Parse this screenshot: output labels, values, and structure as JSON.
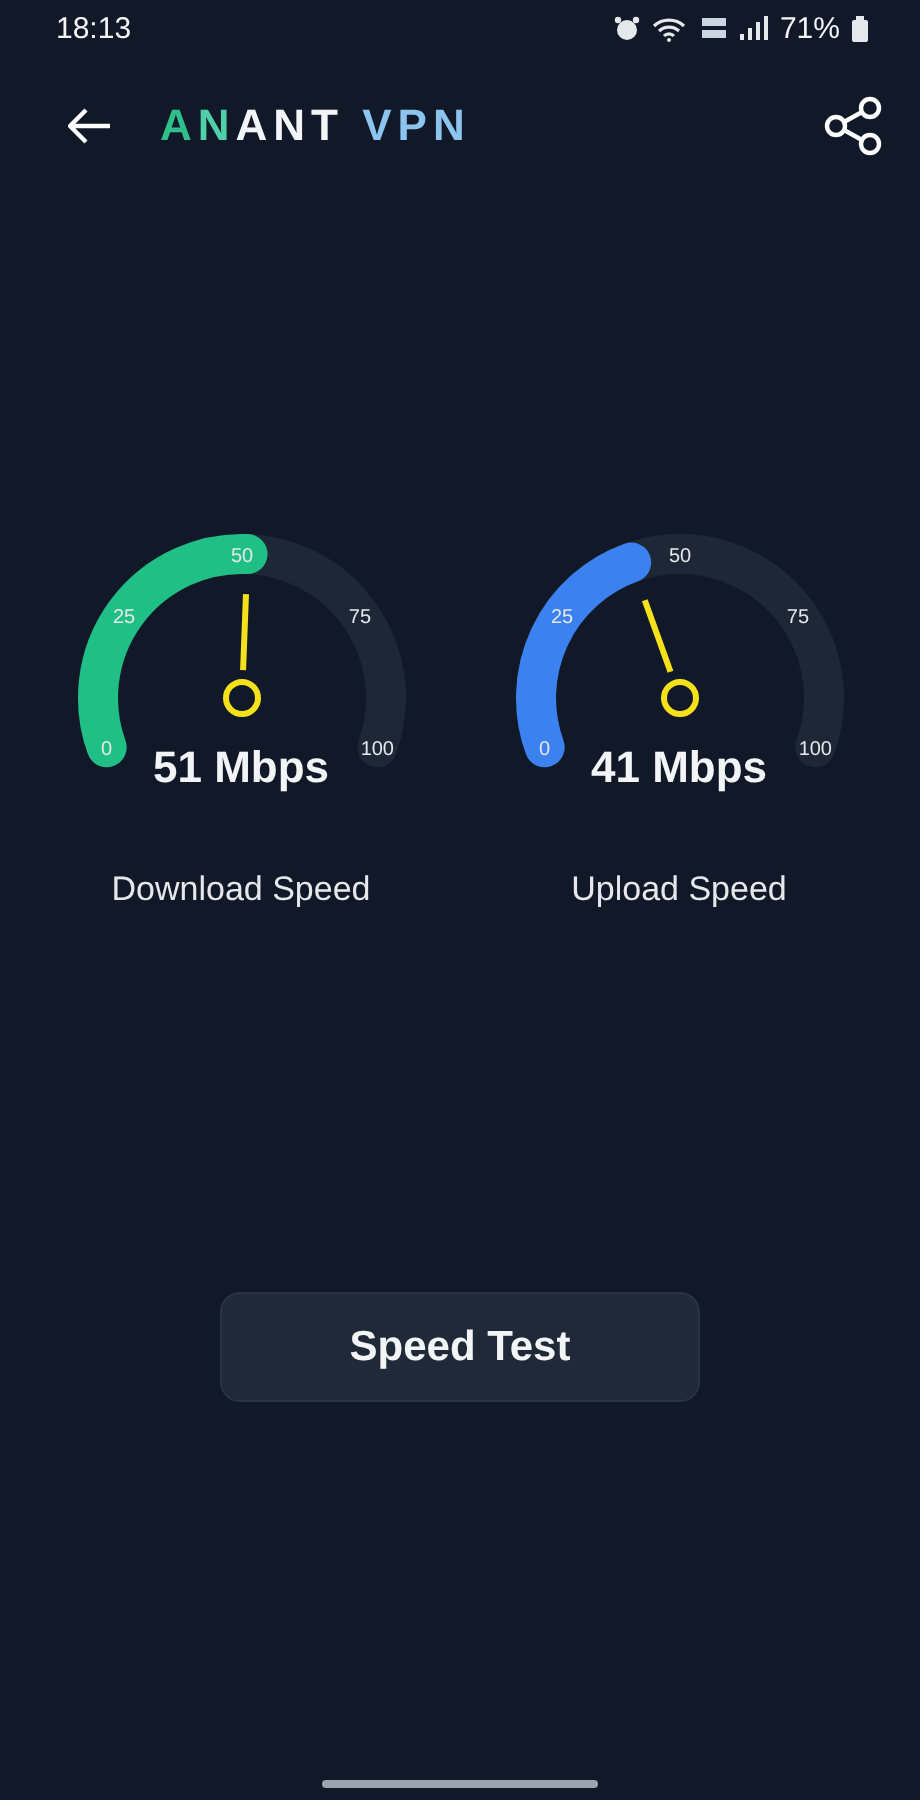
{
  "status_bar": {
    "time": "18:13",
    "battery": "71%"
  },
  "header": {
    "title": [
      {
        "text": "A",
        "color": "#2fbf8c"
      },
      {
        "text": "N",
        "color": "#4fd0a8"
      },
      {
        "text": "ANT",
        "color": "#f2f4f7"
      },
      {
        "text": " VPN",
        "color": "#8cc4f0"
      }
    ]
  },
  "gauges": [
    {
      "label": "Download Speed",
      "value": "51 Mbps",
      "color": "#1fbf86",
      "ticks": [
        "0",
        "25",
        "50",
        "75",
        "100"
      ]
    },
    {
      "label": "Upload Speed",
      "value": "41 Mbps",
      "color": "#3b82f0",
      "ticks": [
        "0",
        "25",
        "50",
        "75",
        "100"
      ]
    }
  ],
  "button": {
    "label": "Speed Test"
  }
}
